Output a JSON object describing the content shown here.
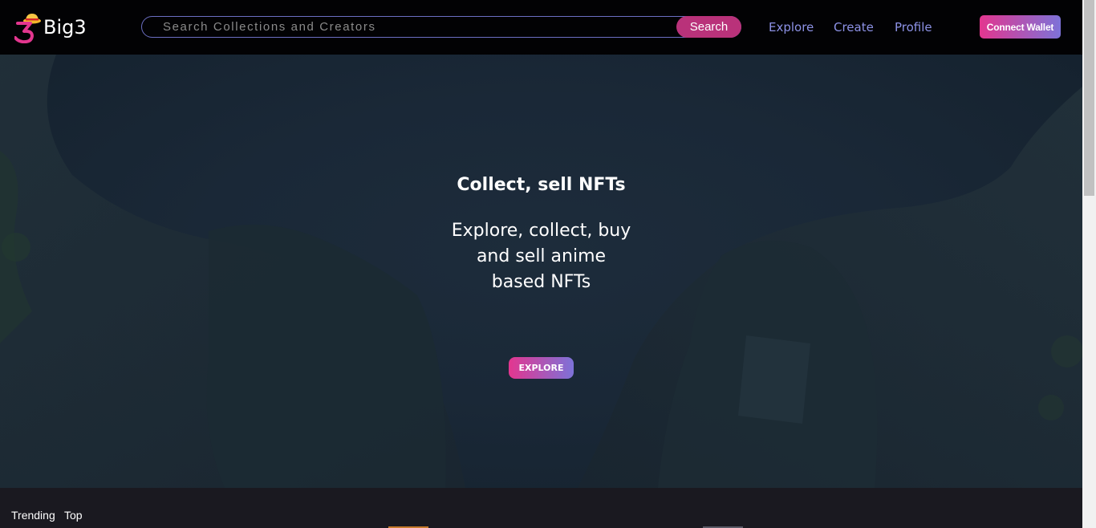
{
  "brand": {
    "name": "Big3"
  },
  "search": {
    "placeholder": "Search Collections and Creators",
    "button_label": "Search"
  },
  "nav": {
    "explore": "Explore",
    "create": "Create",
    "profile": "Profile",
    "connect_wallet": "Connect Wallet"
  },
  "hero": {
    "title": "Collect, sell NFTs",
    "subtitle": "Explore, collect, buy and sell anime based NFTs",
    "button_label": "EXPLORE"
  },
  "tabs": [
    "Trending",
    "Top"
  ],
  "colors": {
    "nav_bg": "#020204",
    "accent_pink": "#e3368f",
    "accent_purple": "#7d72d8",
    "nav_link": "#8d92e6",
    "search_button": "#b9327a",
    "hero_bg": "#1a2837",
    "page_bg": "#1a1920"
  }
}
